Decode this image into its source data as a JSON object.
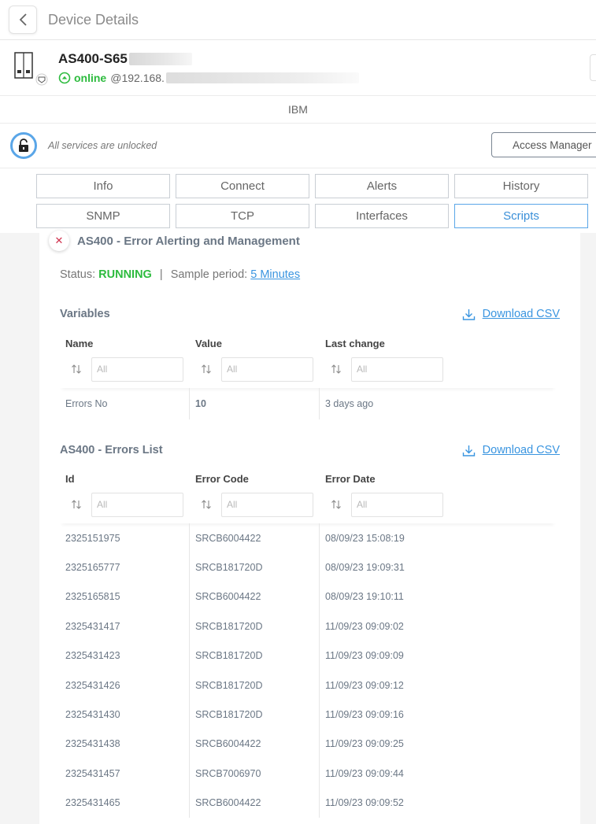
{
  "header": {
    "title": "Device Details"
  },
  "device": {
    "name": "AS400-S65",
    "status": "online",
    "ip": "@192.168.",
    "vendor": "IBM"
  },
  "security": {
    "text": "All services are unlocked",
    "access_manager_label": "Access Manager"
  },
  "tabs": {
    "row1": [
      "Info",
      "Connect",
      "Alerts",
      "History"
    ],
    "row2": [
      "SNMP",
      "TCP",
      "Interfaces",
      "Scripts"
    ],
    "active": "Scripts"
  },
  "script": {
    "title": "AS400 - Error Alerting and Management",
    "status_label": "Status:",
    "status_value": "RUNNING",
    "separator": "|",
    "period_label": "Sample period:",
    "period_value": "5 Minutes"
  },
  "variables": {
    "title": "Variables",
    "download_label": "Download CSV",
    "columns": [
      "Name",
      "Value",
      "Last change"
    ],
    "filter_placeholder": "All",
    "rows": [
      [
        "Errors No",
        "10",
        "3 days ago"
      ]
    ]
  },
  "errors": {
    "title": "AS400 - Errors List",
    "download_label": "Download CSV",
    "columns": [
      "Id",
      "Error Code",
      "Error Date"
    ],
    "filter_placeholder": "All",
    "rows": [
      [
        "2325151975",
        "SRCB6004422",
        "08/09/23 15:08:19"
      ],
      [
        "2325165777",
        "SRCB181720D",
        "08/09/23 19:09:31"
      ],
      [
        "2325165815",
        "SRCB6004422",
        "08/09/23 19:10:11"
      ],
      [
        "2325431417",
        "SRCB181720D",
        "11/09/23 09:09:02"
      ],
      [
        "2325431423",
        "SRCB181720D",
        "11/09/23 09:09:09"
      ],
      [
        "2325431426",
        "SRCB181720D",
        "11/09/23 09:09:12"
      ],
      [
        "2325431430",
        "SRCB181720D",
        "11/09/23 09:09:16"
      ],
      [
        "2325431438",
        "SRCB6004422",
        "11/09/23 09:09:25"
      ],
      [
        "2325431457",
        "SRCB7006970",
        "11/09/23 09:09:44"
      ],
      [
        "2325431465",
        "SRCB6004422",
        "11/09/23 09:09:52"
      ]
    ]
  },
  "colors": {
    "accent": "#3a95e0",
    "online": "#2dbb3e",
    "close": "#d0324e"
  },
  "icons": {
    "back": "chevron-left-icon",
    "device": "server-icon",
    "lock": "unlocked-lock-icon",
    "sort": "sort-icon",
    "download": "download-icon",
    "close": "close-icon",
    "status": "online-arrow-icon"
  }
}
